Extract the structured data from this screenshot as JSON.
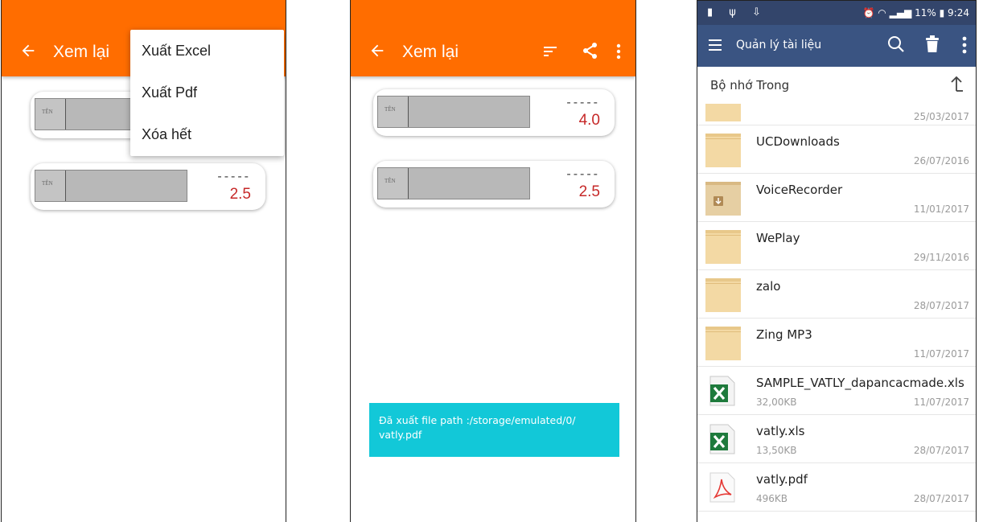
{
  "screen1": {
    "title": "Xem lại",
    "cards": [
      {
        "thumb_label": "TÊN"
      },
      {
        "thumb_label": "TÊN",
        "dash": "-----",
        "score": "2.5"
      }
    ],
    "menu": [
      "Xuất Excel",
      "Xuất Pdf",
      "Xóa hết"
    ]
  },
  "screen2": {
    "title": "Xem lại",
    "cards": [
      {
        "thumb_label": "TÊN",
        "dash": "-----",
        "score": "4.0"
      },
      {
        "thumb_label": "TÊN",
        "dash": "-----",
        "score": "2.5"
      }
    ],
    "toast": "Đã xuất file path :/storage/emulated/0/ vatly.pdf"
  },
  "screen3": {
    "status": {
      "time": "9:24",
      "battery": "11%"
    },
    "title": "Quản lý tài liệu",
    "path": "Bộ nhớ Trong",
    "files": [
      {
        "name": "",
        "date": "25/03/2017",
        "icon": "folder-icon"
      },
      {
        "name": "UCDownloads",
        "date": "26/07/2016",
        "icon": "folder-icon"
      },
      {
        "name": "VoiceRecorder",
        "date": "11/01/2017",
        "icon": "folder-download-icon"
      },
      {
        "name": "WePlay",
        "date": "29/11/2016",
        "icon": "folder-icon"
      },
      {
        "name": "zalo",
        "date": "28/07/2017",
        "icon": "folder-icon"
      },
      {
        "name": "Zing MP3",
        "date": "11/07/2017",
        "icon": "folder-icon"
      },
      {
        "name": "SAMPLE_VATLY_dapancacmade.xls",
        "size": "32,00KB",
        "date": "11/07/2017",
        "icon": "excel-icon"
      },
      {
        "name": "vatly.xls",
        "size": "13,50KB",
        "date": "28/07/2017",
        "icon": "excel-icon"
      },
      {
        "name": "vatly.pdf",
        "size": "496KB",
        "date": "28/07/2017",
        "icon": "pdf-icon"
      }
    ]
  },
  "colors": {
    "accent": "#ff6d00",
    "toast": "#12c8d8",
    "score": "#c62828",
    "fm_bar": "#3a5482"
  }
}
